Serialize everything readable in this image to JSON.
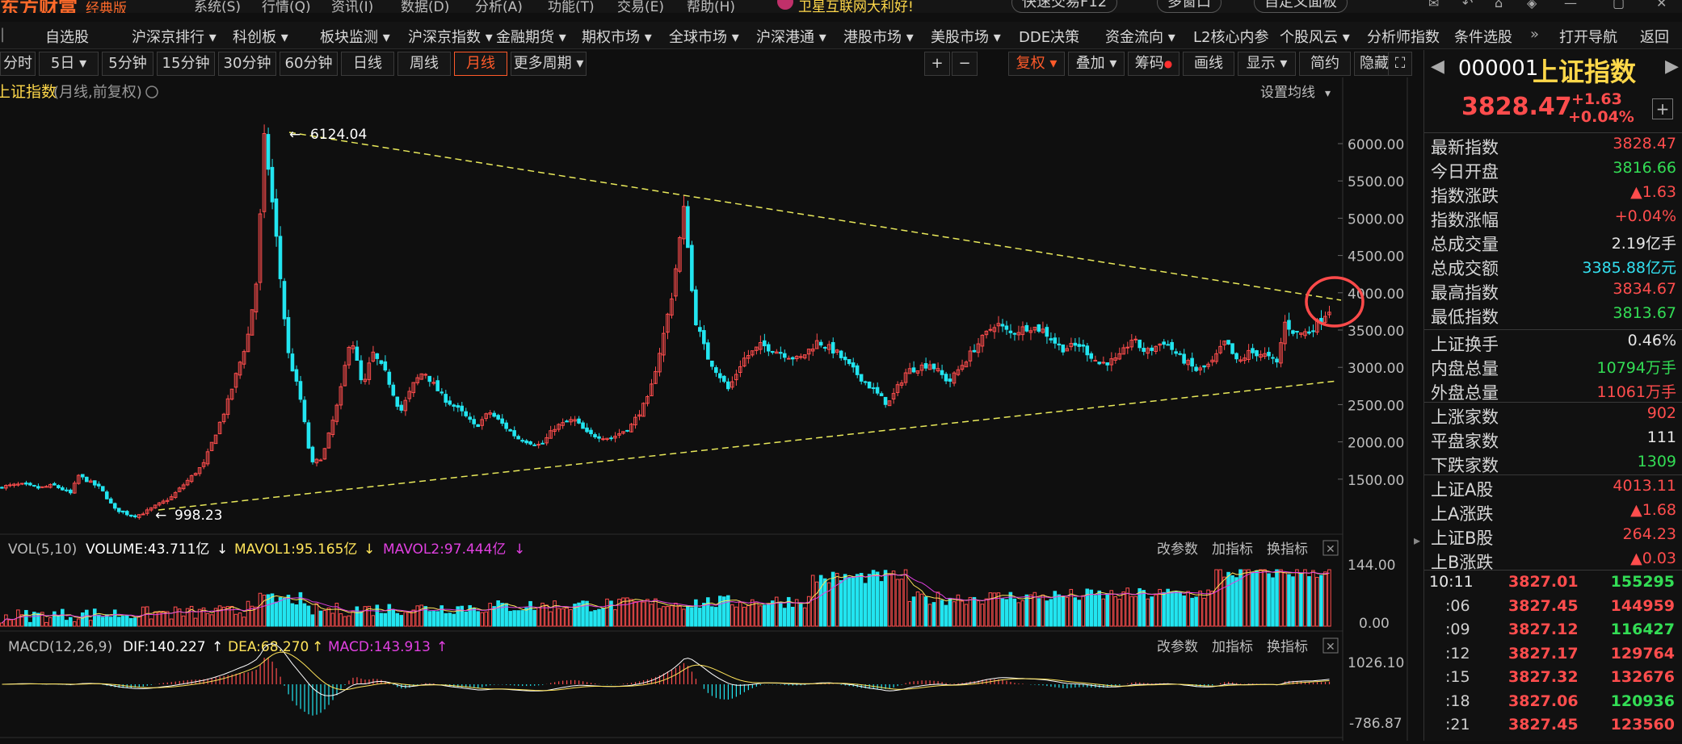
{
  "titlebar": {
    "brand": "东方财富",
    "edition": "经典版",
    "menus": [
      "系统(S)",
      "行情(Q)",
      "资讯(I)",
      "数据(D)",
      "分析(A)",
      "功能(T)",
      "交易(E)",
      "帮助(H)"
    ],
    "promo": "卫星互联网大利好!",
    "quick_trade": "快速交易F12",
    "multi_window": "多窗口",
    "custom_panel": "自定义面板"
  },
  "navbar": {
    "items": [
      "自选股",
      "沪深京排行",
      "科创板",
      "板块监测",
      "沪深京指数",
      "金融期货",
      "期权市场",
      "全球市场",
      "沪深港通",
      "港股市场",
      "美股市场",
      "DDE决策",
      "资金流向",
      "L2核心内参",
      "个股风云",
      "分析师指数",
      "条件选股",
      "打开导航",
      "返回"
    ]
  },
  "periods": {
    "items": [
      "分时",
      "5日",
      "5分钟",
      "15分钟",
      "30分钟",
      "60分钟",
      "日线",
      "周线",
      "月线",
      "更多周期"
    ],
    "active": "月线"
  },
  "chart_toolbar": {
    "plus": "+",
    "minus": "−",
    "fuquan": "复权",
    "overlay": "叠加",
    "chips": "筹码",
    "draw": "画线",
    "display": "显示",
    "simple": "简约",
    "hide": "隐藏"
  },
  "chart_header": {
    "name": "上证指数",
    "mode": "(月线,前复权)",
    "ma_setting": "设置均线"
  },
  "main_chart": {
    "high_label": "6124.04",
    "low_label": "998.23",
    "y_ticks": [
      "6000.00",
      "5500.00",
      "5000.00",
      "4500.00",
      "4000.00",
      "3500.00",
      "3000.00",
      "2500.00",
      "2000.00",
      "1500.00"
    ]
  },
  "vol_panel": {
    "title": "VOL(5,10)",
    "volume": "VOLUME:43.711亿",
    "mavol1": "MAVOL1:95.165亿",
    "mavol2": "MAVOL2:97.444亿",
    "y_ticks": [
      "144.00",
      "0.00"
    ],
    "btn_params": "改参数",
    "btn_add": "加指标",
    "btn_switch": "换指标"
  },
  "macd_panel": {
    "title": "MACD(12,26,9)",
    "dif": "DIF:140.227",
    "dea": "DEA:68.270",
    "macd": "MACD:143.913",
    "y_ticks": [
      "1026.10",
      "-786.87"
    ],
    "btn_params": "改参数",
    "btn_add": "加指标",
    "btn_switch": "换指标"
  },
  "quote": {
    "code": "000001",
    "name": "上证指数",
    "price": "3828.47",
    "change": "+1.63",
    "change_pct": "+0.04%",
    "rows1": [
      {
        "label": "最新指数",
        "value": "3828.47",
        "color": "#ff4d4d"
      },
      {
        "label": "今日开盘",
        "value": "3816.66",
        "color": "#33dd55"
      },
      {
        "label": "指数涨跌",
        "value": "▲1.63",
        "color": "#ff4d4d"
      },
      {
        "label": "指数涨幅",
        "value": "+0.04%",
        "color": "#ff4d4d"
      },
      {
        "label": "总成交量",
        "value": "2.19亿手",
        "color": "#e6e6e6"
      },
      {
        "label": "总成交额",
        "value": "3385.88亿元",
        "color": "#33e0f0"
      },
      {
        "label": "最高指数",
        "value": "3834.67",
        "color": "#ff4d4d"
      },
      {
        "label": "最低指数",
        "value": "3813.67",
        "color": "#33dd55"
      }
    ],
    "rows2": [
      {
        "label": "上证换手",
        "value": "0.46%",
        "color": "#e6e6e6"
      },
      {
        "label": "内盘总量",
        "value": "10794万手",
        "color": "#33dd55"
      },
      {
        "label": "外盘总量",
        "value": "11061万手",
        "color": "#ff4d4d"
      }
    ],
    "rows3": [
      {
        "label": "上涨家数",
        "value": "902",
        "color": "#ff4d4d"
      },
      {
        "label": "平盘家数",
        "value": "111",
        "color": "#e6e6e6"
      },
      {
        "label": "下跌家数",
        "value": "1309",
        "color": "#33dd55"
      }
    ],
    "rows4": [
      {
        "label": "上证A股",
        "value": "4013.11",
        "color": "#ff4d4d"
      },
      {
        "label": "上A涨跌",
        "value": "▲1.68",
        "color": "#ff4d4d"
      },
      {
        "label": "上证B股",
        "value": "264.23",
        "color": "#ff4d4d"
      },
      {
        "label": "上B涨跌",
        "value": "▲0.03",
        "color": "#ff4d4d"
      }
    ],
    "ticks": [
      {
        "time": "10:11",
        "price": "3827.01",
        "vol": "155295",
        "vol_color": "#33dd55"
      },
      {
        "time": ":06",
        "price": "3827.45",
        "vol": "144959",
        "vol_color": "#ff4d4d"
      },
      {
        "time": ":09",
        "price": "3827.12",
        "vol": "116427",
        "vol_color": "#33dd55"
      },
      {
        "time": ":12",
        "price": "3827.17",
        "vol": "129764",
        "vol_color": "#ff4d4d"
      },
      {
        "time": ":15",
        "price": "3827.32",
        "vol": "132676",
        "vol_color": "#ff4d4d"
      },
      {
        "time": ":18",
        "price": "3827.06",
        "vol": "120936",
        "vol_color": "#33dd55"
      },
      {
        "time": ":21",
        "price": "3827.45",
        "vol": "123560",
        "vol_color": "#ff4d4d"
      }
    ]
  },
  "colors": {
    "up": "#ff4d4d",
    "down": "#22e5f0",
    "accent": "#ff5a2a",
    "trendline": "#e8e85a",
    "dif": "#ffffff",
    "dea": "#ffe45a",
    "macd_label": "#e040e0"
  }
}
